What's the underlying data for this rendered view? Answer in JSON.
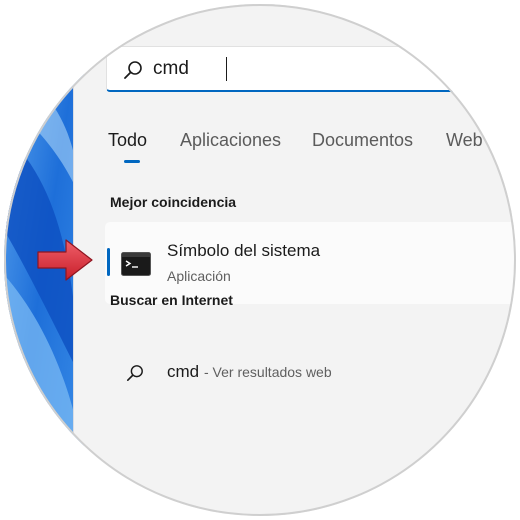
{
  "search": {
    "value": "cmd",
    "placeholder": ""
  },
  "tabs": [
    {
      "label": "Todo",
      "active": true
    },
    {
      "label": "Aplicaciones",
      "active": false
    },
    {
      "label": "Documentos",
      "active": false
    },
    {
      "label": "Web",
      "active": false
    }
  ],
  "best_match": {
    "heading": "Mejor coincidencia",
    "title": "Símbolo del sistema",
    "subtitle": "Aplicación",
    "icon": "cmd-terminal-icon"
  },
  "web": {
    "heading": "Buscar en Internet",
    "query": "cmd",
    "suffix": "- Ver resultados web",
    "icon": "search-icon"
  },
  "colors": {
    "accent": "#0067c0",
    "panel_bg": "#f3f3f3",
    "arrow": "#e23b45",
    "wallpaper": "#1e6fd9"
  }
}
